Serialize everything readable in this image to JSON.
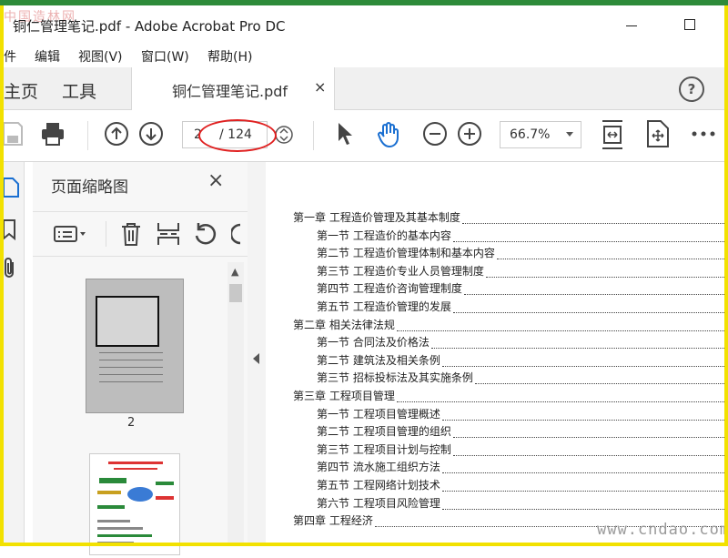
{
  "app": {
    "watermark_top": "中国造林网",
    "window_title": "铜仁管理笔记.pdf - Adobe Acrobat Pro DC"
  },
  "menu": [
    "件",
    "编辑",
    "视图(V)",
    "窗口(W)",
    "帮助(H)"
  ],
  "tabs": {
    "home": "主页",
    "tools": "工具",
    "document": "铜仁管理笔记.pdf",
    "close": "×",
    "help": "?"
  },
  "toolbar": {
    "current_page": "2",
    "total_pages": "/ 124",
    "zoom": "66.7%"
  },
  "panel": {
    "title": "页面缩略图",
    "close": "×",
    "thumb_label": "2"
  },
  "toc": [
    {
      "text": "第一章   工程造价管理及其基本制度",
      "indent": false
    },
    {
      "text": "第一节  工程造价的基本内容",
      "indent": true
    },
    {
      "text": "第二节  工程造价管理体制和基本内容",
      "indent": true
    },
    {
      "text": "第三节  工程造价专业人员管理制度",
      "indent": true
    },
    {
      "text": "第四节  工程造价咨询管理制度",
      "indent": true
    },
    {
      "text": "第五节   工程造价管理的发展",
      "indent": true
    },
    {
      "text": "第二章  相关法律法规",
      "indent": false
    },
    {
      "text": "第一节  合同法及价格法",
      "indent": true
    },
    {
      "text": "第二节  建筑法及相关条例",
      "indent": true
    },
    {
      "text": "第三节   招标投标法及其实施条例",
      "indent": true
    },
    {
      "text": "第三章  工程项目管理",
      "indent": false
    },
    {
      "text": "第一节  工程项目管理概述",
      "indent": true
    },
    {
      "text": "第二节  工程项目管理的组织",
      "indent": true
    },
    {
      "text": "第三节  工程项目计划与控制",
      "indent": true
    },
    {
      "text": "第四节  流水施工组织方法",
      "indent": true
    },
    {
      "text": "第五节  工程网络计划技术",
      "indent": true
    },
    {
      "text": "第六节  工程项目风险管理",
      "indent": true
    },
    {
      "text": "第四章  工程经济",
      "indent": false
    }
  ],
  "footer_watermark": "www.cndao.com"
}
